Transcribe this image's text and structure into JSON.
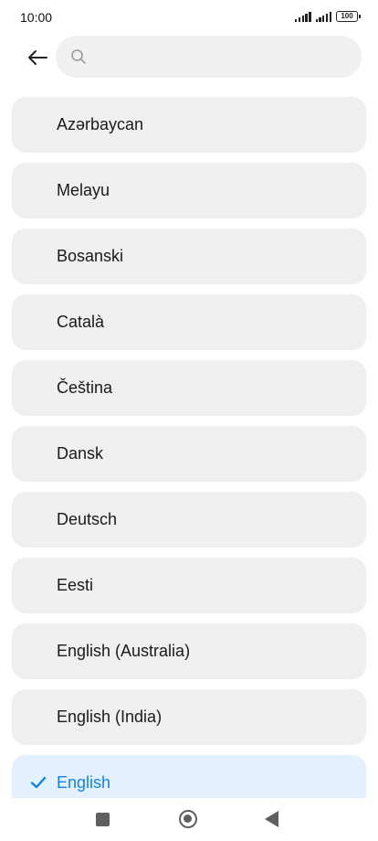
{
  "status_bar": {
    "time": "10:00",
    "battery": "100"
  },
  "search": {
    "placeholder": "",
    "value": ""
  },
  "languages": [
    {
      "label": "Azərbaycan",
      "selected": false
    },
    {
      "label": "Melayu",
      "selected": false
    },
    {
      "label": "Bosanski",
      "selected": false
    },
    {
      "label": "Català",
      "selected": false
    },
    {
      "label": "Čeština",
      "selected": false
    },
    {
      "label": "Dansk",
      "selected": false
    },
    {
      "label": "Deutsch",
      "selected": false
    },
    {
      "label": "Eesti",
      "selected": false
    },
    {
      "label": "English (Australia)",
      "selected": false
    },
    {
      "label": "English (India)",
      "selected": false
    },
    {
      "label": "English",
      "selected": true
    }
  ],
  "icons": {
    "back": "back-arrow-icon",
    "search": "search-icon",
    "check": "check-icon",
    "nav_recents": "recents-square-icon",
    "nav_home": "home-circle-icon",
    "nav_back": "back-triangle-icon"
  },
  "colors": {
    "selected_text": "#0f83e8",
    "selected_bg": "#e2f1fd",
    "item_bg": "#efefef",
    "search_bg": "#f0f0f0"
  }
}
